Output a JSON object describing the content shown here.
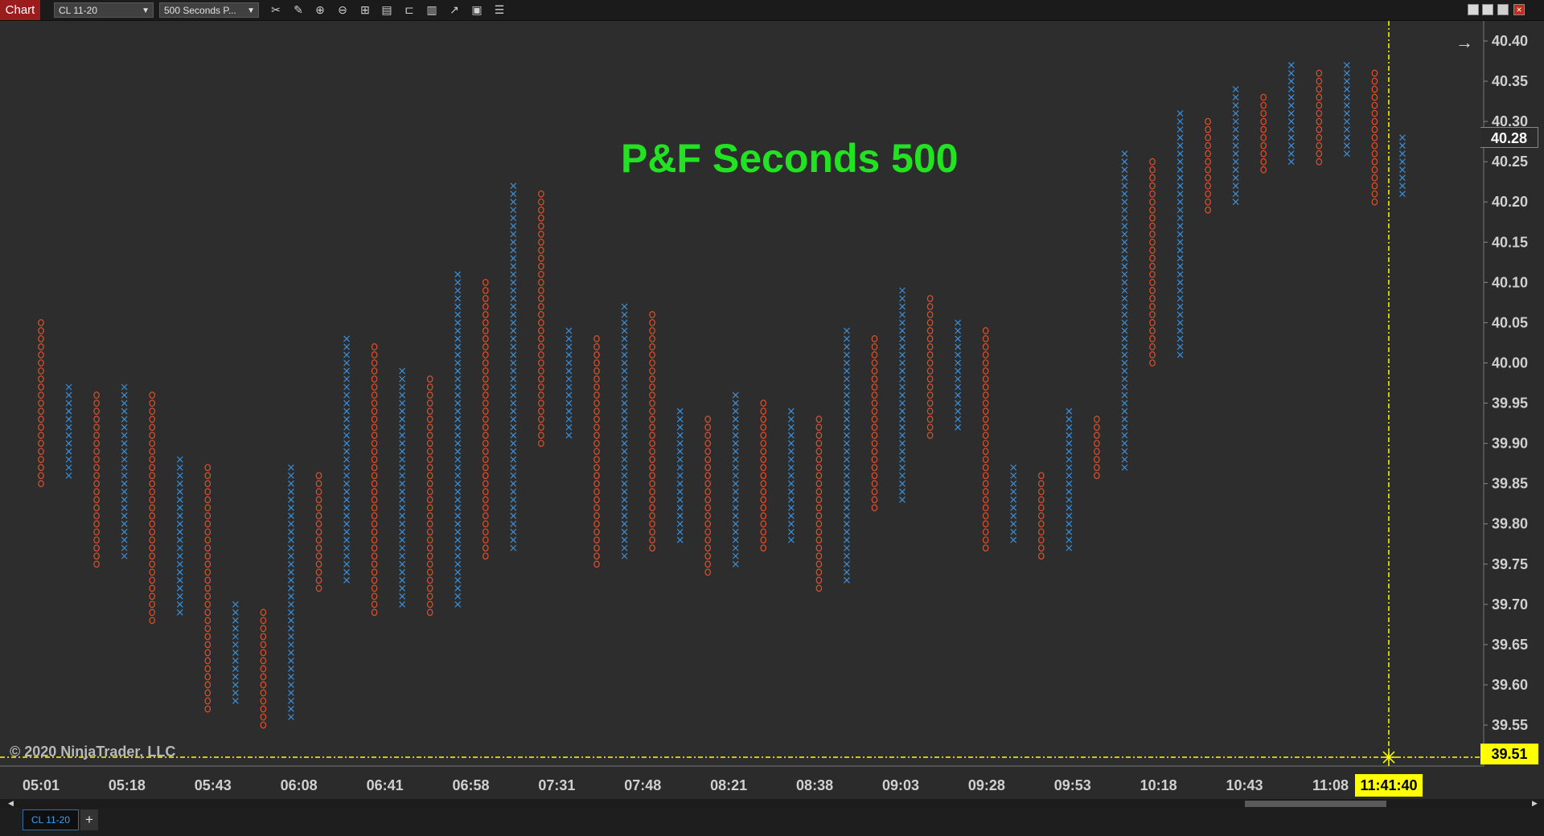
{
  "toolbar": {
    "chart_tab_label": "Chart",
    "instrument": "CL 11-20",
    "period": "500 Seconds P...",
    "tools": [
      "scissors-icon",
      "pencil-icon",
      "zoom-in-icon",
      "zoom-out-icon",
      "crosshair-icon",
      "properties-icon",
      "data-box-icon",
      "bar-chart-icon",
      "indicators-icon",
      "strategies-icon",
      "list-icon"
    ],
    "window_buttons": [
      "restore-icon",
      "maximize-icon",
      "minimize-icon",
      "close-icon"
    ]
  },
  "chart_title": "P&F Seconds 500",
  "copyright": "© 2020 NinjaTrader, LLC",
  "last_price_label": "40.28",
  "crosshair_price_label": "39.51",
  "crosshair_time_label": "11:41:40",
  "bottom": {
    "instrument_tab": "CL 11-20",
    "add_tab": "+"
  },
  "colors": {
    "up": "#3a8fd9",
    "down": "#e0512b",
    "crosshair": "#ffff00",
    "title": "#22e322",
    "background": "#2d2d2d"
  },
  "chart_data": {
    "type": "point-and-figure",
    "title": "P&F Seconds 500",
    "box_size": 0.01,
    "y_ticks": [
      "40.40",
      "40.35",
      "40.30",
      "40.25",
      "40.20",
      "40.15",
      "40.10",
      "40.05",
      "40.00",
      "39.95",
      "39.90",
      "39.85",
      "39.80",
      "39.75",
      "39.70",
      "39.65",
      "39.60",
      "39.55"
    ],
    "ylim": [
      39.51,
      40.42
    ],
    "x_tick_labels": [
      "05:01",
      "05:18",
      "05:43",
      "06:08",
      "06:41",
      "06:58",
      "07:31",
      "07:48",
      "08:21",
      "08:38",
      "09:03",
      "09:28",
      "09:53",
      "10:18",
      "10:43",
      "11:08"
    ],
    "columns": [
      {
        "type": "O",
        "high": 40.05,
        "low": 39.85
      },
      {
        "type": "X",
        "high": 39.97,
        "low": 39.86
      },
      {
        "type": "O",
        "high": 39.96,
        "low": 39.75
      },
      {
        "type": "X",
        "high": 39.97,
        "low": 39.76
      },
      {
        "type": "O",
        "high": 39.96,
        "low": 39.68
      },
      {
        "type": "X",
        "high": 39.88,
        "low": 39.69
      },
      {
        "type": "O",
        "high": 39.87,
        "low": 39.57
      },
      {
        "type": "X",
        "high": 39.7,
        "low": 39.58
      },
      {
        "type": "O",
        "high": 39.69,
        "low": 39.55
      },
      {
        "type": "X",
        "high": 39.87,
        "low": 39.56
      },
      {
        "type": "O",
        "high": 39.86,
        "low": 39.72
      },
      {
        "type": "X",
        "high": 40.03,
        "low": 39.73
      },
      {
        "type": "O",
        "high": 40.02,
        "low": 39.69
      },
      {
        "type": "X",
        "high": 39.99,
        "low": 39.7
      },
      {
        "type": "O",
        "high": 39.98,
        "low": 39.69
      },
      {
        "type": "X",
        "high": 40.11,
        "low": 39.7
      },
      {
        "type": "O",
        "high": 40.1,
        "low": 39.76
      },
      {
        "type": "X",
        "high": 40.22,
        "low": 39.77
      },
      {
        "type": "O",
        "high": 40.21,
        "low": 39.9
      },
      {
        "type": "X",
        "high": 40.04,
        "low": 39.91
      },
      {
        "type": "O",
        "high": 40.03,
        "low": 39.75
      },
      {
        "type": "X",
        "high": 40.07,
        "low": 39.76
      },
      {
        "type": "O",
        "high": 40.06,
        "low": 39.77
      },
      {
        "type": "X",
        "high": 39.94,
        "low": 39.78
      },
      {
        "type": "O",
        "high": 39.93,
        "low": 39.74
      },
      {
        "type": "X",
        "high": 39.96,
        "low": 39.75
      },
      {
        "type": "O",
        "high": 39.95,
        "low": 39.77
      },
      {
        "type": "X",
        "high": 39.94,
        "low": 39.78
      },
      {
        "type": "O",
        "high": 39.93,
        "low": 39.72
      },
      {
        "type": "X",
        "high": 40.04,
        "low": 39.73
      },
      {
        "type": "O",
        "high": 40.03,
        "low": 39.82
      },
      {
        "type": "X",
        "high": 40.09,
        "low": 39.83
      },
      {
        "type": "O",
        "high": 40.08,
        "low": 39.91
      },
      {
        "type": "X",
        "high": 40.05,
        "low": 39.92
      },
      {
        "type": "O",
        "high": 40.04,
        "low": 39.77
      },
      {
        "type": "X",
        "high": 39.87,
        "low": 39.78
      },
      {
        "type": "O",
        "high": 39.86,
        "low": 39.76
      },
      {
        "type": "X",
        "high": 39.94,
        "low": 39.77
      },
      {
        "type": "O",
        "high": 39.93,
        "low": 39.86
      },
      {
        "type": "X",
        "high": 40.26,
        "low": 39.87
      },
      {
        "type": "O",
        "high": 40.25,
        "low": 40.0
      },
      {
        "type": "X",
        "high": 40.31,
        "low": 40.01
      },
      {
        "type": "O",
        "high": 40.3,
        "low": 40.19
      },
      {
        "type": "X",
        "high": 40.34,
        "low": 40.2
      },
      {
        "type": "O",
        "high": 40.33,
        "low": 40.24
      },
      {
        "type": "X",
        "high": 40.37,
        "low": 40.25
      },
      {
        "type": "O",
        "high": 40.36,
        "low": 40.25
      },
      {
        "type": "X",
        "high": 40.37,
        "low": 40.26
      },
      {
        "type": "O",
        "high": 40.36,
        "low": 40.2
      },
      {
        "type": "X",
        "high": 40.28,
        "low": 40.21
      }
    ],
    "last_price": 40.28,
    "crosshair_price": 39.51,
    "crosshair_time": "11:41:40",
    "grid": false
  }
}
